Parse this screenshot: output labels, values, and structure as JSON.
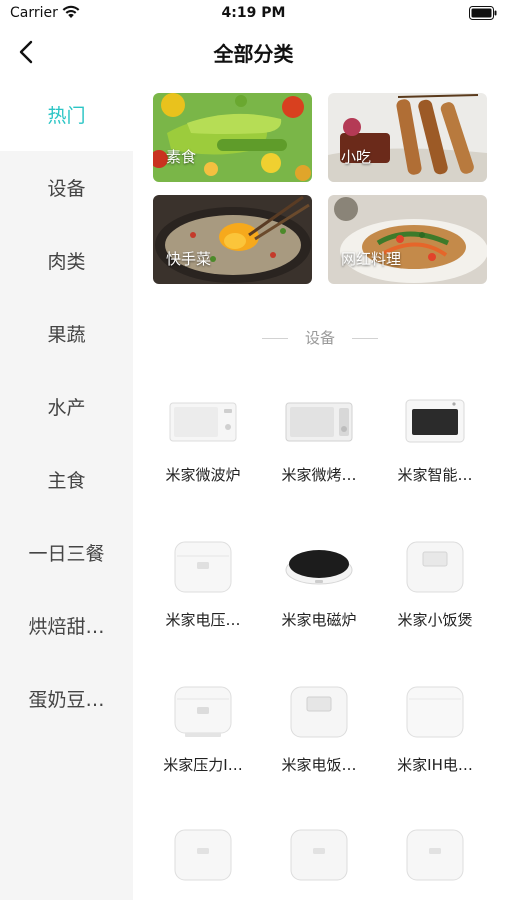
{
  "status_bar": {
    "carrier": "Carrier",
    "time": "4:19 PM"
  },
  "nav": {
    "title": "全部分类"
  },
  "sidebar": {
    "items": [
      {
        "label": "热门",
        "active": true
      },
      {
        "label": "设备"
      },
      {
        "label": "肉类"
      },
      {
        "label": "果蔬"
      },
      {
        "label": "水产"
      },
      {
        "label": "主食"
      },
      {
        "label": "一日三餐"
      },
      {
        "label": "烘焙甜…"
      },
      {
        "label": "蛋奶豆…"
      }
    ]
  },
  "hot": {
    "cards": [
      {
        "label": "素食"
      },
      {
        "label": "小吃"
      },
      {
        "label": "快手菜"
      },
      {
        "label": "网红料理"
      }
    ]
  },
  "devices": {
    "section_title": "设备",
    "items": [
      {
        "label": "米家微波炉"
      },
      {
        "label": "米家微烤…"
      },
      {
        "label": "米家智能…"
      },
      {
        "label": "米家电压…"
      },
      {
        "label": "米家电磁炉"
      },
      {
        "label": "米家小饭煲"
      },
      {
        "label": "米家压力I…"
      },
      {
        "label": "米家电饭…"
      },
      {
        "label": "米家IH电…"
      }
    ]
  },
  "theme": {
    "accent": "#2bc5c5",
    "sidebar_bg": "#f5f5f5"
  }
}
